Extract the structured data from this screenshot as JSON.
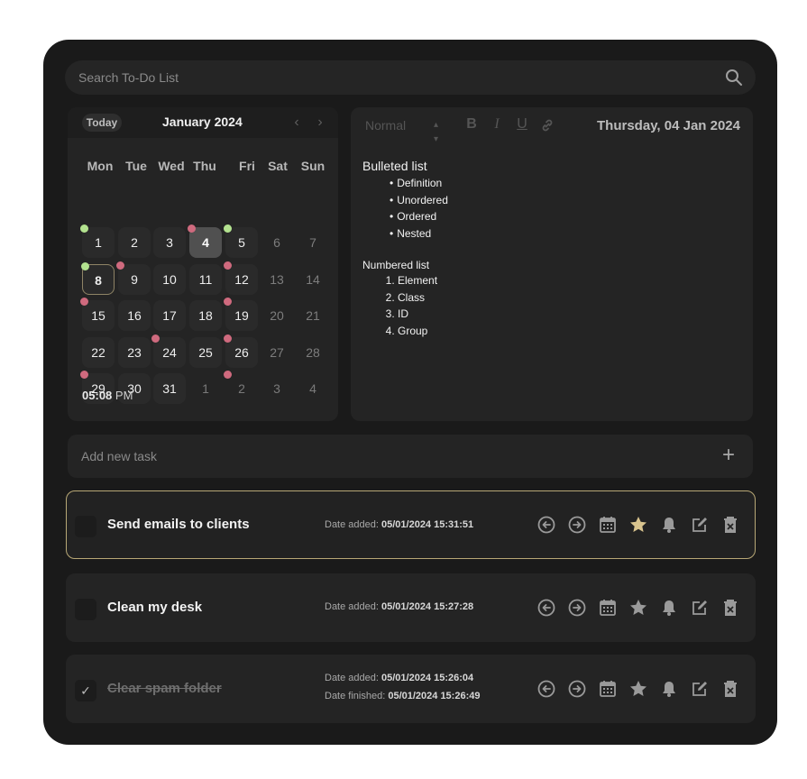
{
  "search": {
    "placeholder": "Search To-Do List"
  },
  "calendar": {
    "today_label": "Today",
    "month_label": "January 2024",
    "prev_arrow": "‹",
    "next_arrow": "›",
    "weekdays": [
      "Mon",
      "Tue",
      "Wed",
      "Thu",
      "Fri",
      "Sat",
      "Sun"
    ],
    "weeks": [
      [
        "1",
        "2",
        "3",
        "4",
        "5",
        "6",
        "7"
      ],
      [
        "8",
        "9",
        "10",
        "11",
        "12",
        "13",
        "14"
      ],
      [
        "15",
        "16",
        "17",
        "18",
        "19",
        "20",
        "21"
      ],
      [
        "22",
        "23",
        "24",
        "25",
        "26",
        "27",
        "28"
      ],
      [
        "29",
        "30",
        "31",
        "1",
        "2",
        "3",
        "4"
      ]
    ],
    "selected_day": "4",
    "today_day": "8",
    "time": {
      "hour": "05",
      "minute": "08",
      "separator": ":",
      "ampm": "PM"
    },
    "hour_slider_value": 5,
    "minute_slider_value": 8
  },
  "editor": {
    "style_select": "Normal",
    "bold": "B",
    "italic": "I",
    "underline": "U",
    "date": "Thursday, 04 Jan 2024",
    "bulleted_title": "Bulleted list",
    "bullets": [
      "Definition",
      "Unordered",
      "Ordered",
      "Nested"
    ],
    "numbered_title": "Numbered list",
    "numbered": [
      "Element",
      "Class",
      "ID",
      "Group"
    ]
  },
  "add_task": {
    "placeholder": "Add new task",
    "plus": "+"
  },
  "tasks": [
    {
      "name": "Send emails to clients",
      "added_label": "Date added:",
      "added": "05/01/2024 15:31:51",
      "starred": true,
      "done": false
    },
    {
      "name": "Clean my desk",
      "added_label": "Date added:",
      "added": "05/01/2024 15:27:28",
      "starred": false,
      "done": false
    },
    {
      "name": "Clear spam folder",
      "added_label": "Date added:",
      "added": "05/01/2024 15:26:04",
      "finished_label": "Date finished:",
      "finished": "05/01/2024 15:26:49",
      "starred": false,
      "done": true,
      "check": "✓"
    }
  ],
  "colors": {
    "star_active": "#d9c48e",
    "icon": "#9a9a9a",
    "dot_red": "#cf6a7e",
    "dot_green": "#b3e28f",
    "accent_border": "#b8a876"
  }
}
